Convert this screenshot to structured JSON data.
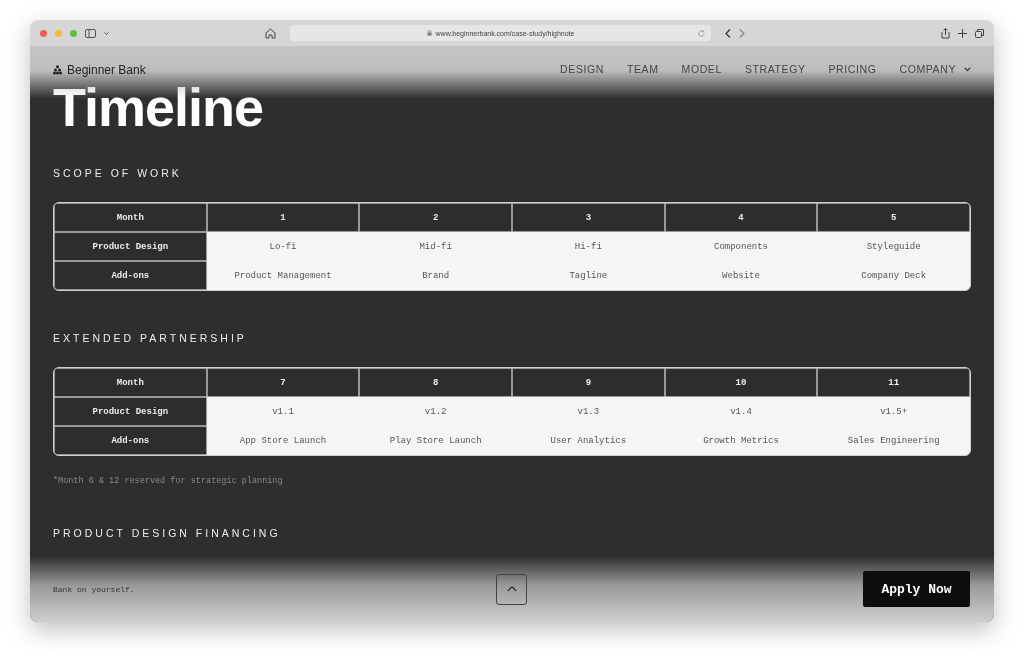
{
  "browser": {
    "url": "www.beginnerbank.com/case-study/highnote"
  },
  "nav": {
    "brand": "Beginner Bank",
    "links": [
      "DESIGN",
      "TEAM",
      "MODEL",
      "STRATEGY",
      "PRICING",
      "COMPANY"
    ]
  },
  "heading": "Timeline",
  "sections": [
    {
      "title": "SCOPE OF WORK",
      "table": {
        "columns": [
          "Month",
          "1",
          "2",
          "3",
          "4",
          "5"
        ],
        "rows": [
          [
            "Product Design",
            "Lo-fi",
            "Mid-fi",
            "Hi-fi",
            "Components",
            "Styleguide"
          ],
          [
            "Add-ons",
            "Product Management",
            "Brand",
            "Tagline",
            "Website",
            "Company Deck"
          ]
        ]
      }
    },
    {
      "title": "EXTENDED PARTNERSHIP",
      "table": {
        "columns": [
          "Month",
          "7",
          "8",
          "9",
          "10",
          "11"
        ],
        "rows": [
          [
            "Product Design",
            "v1.1",
            "v1.2",
            "v1.3",
            "v1.4",
            "v1.5+"
          ],
          [
            "Add-ons",
            "App Store Launch",
            "Play Store Launch",
            "User Analytics",
            "Growth Metrics",
            "Sales Engineering"
          ]
        ]
      }
    }
  ],
  "note": "*Month 6 & 12 reserved for strategic planning",
  "financing_title": "PRODUCT DESIGN FINANCING",
  "footer": {
    "tagline": "Bank on yourself.",
    "button": "Apply Now"
  }
}
